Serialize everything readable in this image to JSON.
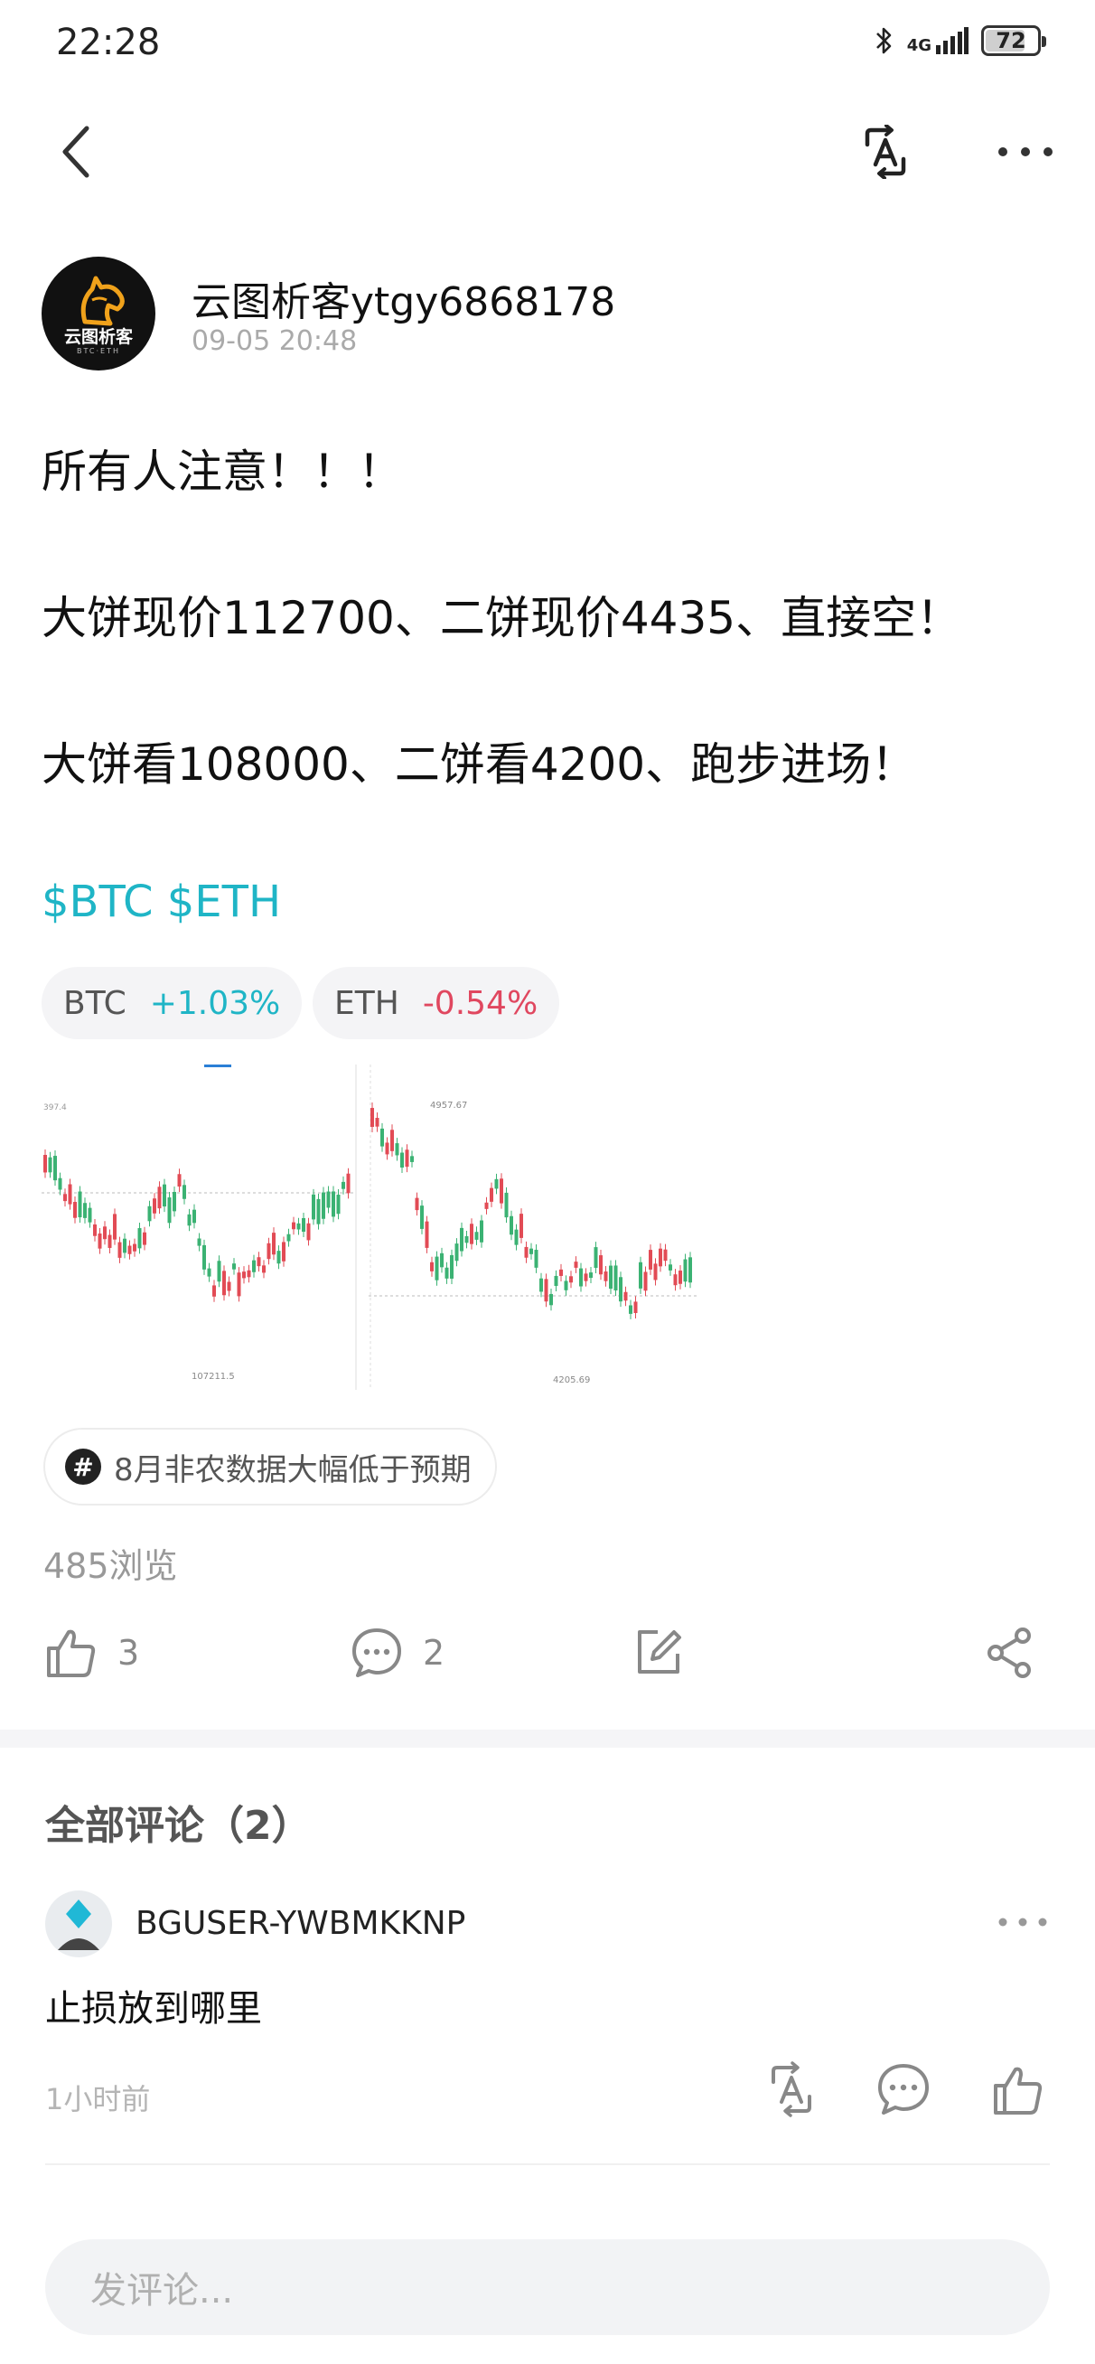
{
  "status": {
    "time": "22:28",
    "network": "4G",
    "battery": "72",
    "battery_level": 0.72
  },
  "nav": {
    "back_icon": "chevron-left-icon",
    "translate_icon": "translate-icon",
    "more_icon": "more-horizontal-icon"
  },
  "author": {
    "name": "云图析客ytgy6868178",
    "time": "09-05 20:48",
    "avatar_text": "云图析客",
    "avatar_subtext": "BTC·ETH"
  },
  "post": {
    "line1": "所有人注意！！！",
    "line2": "大饼现价112700、二饼现价4435、直接空！",
    "line3": "大饼看108000、二饼看4200、跑步进场！",
    "tickers": "$BTC $ETH"
  },
  "chips": [
    {
      "symbol": "BTC",
      "change": "+1.03%",
      "color": "#1fb5c6"
    },
    {
      "symbol": "ETH",
      "change": "-0.54%",
      "color": "#e0475f"
    }
  ],
  "charts": {
    "btc": {
      "high_label": "397.4",
      "low_label": "107211.5"
    },
    "eth": {
      "high_label": "4957.67",
      "low_label": "4205.69"
    }
  },
  "topic": {
    "icon": "#",
    "text": "8月非农数据大幅低于预期"
  },
  "views": "485浏览",
  "actions": {
    "likes": "3",
    "comments": "2"
  },
  "comments": {
    "title": "全部评论（2）",
    "items": [
      {
        "user": "BGUSER-YWBMKKNP",
        "text": "止损放到哪里",
        "time": "1小时前"
      }
    ]
  },
  "input": {
    "placeholder": "发评论..."
  },
  "colors": {
    "accent": "#1fb5c6",
    "down": "#e0475f",
    "up": "#1fb5c6"
  }
}
